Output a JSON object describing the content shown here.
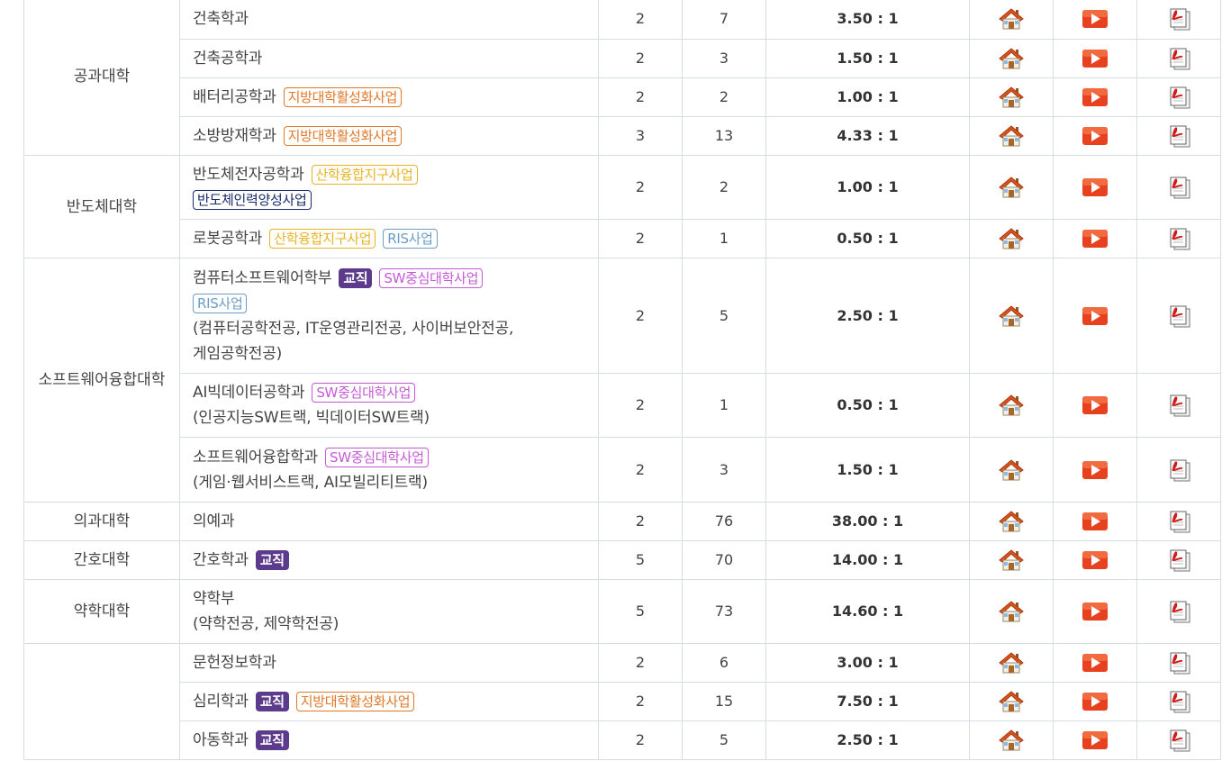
{
  "colors": {
    "orange": "#e0792a",
    "yellow": "#e8b422",
    "navy": "#1a2a6c",
    "blue": "#6b9cc7",
    "violet": "#c45ad6",
    "purple": "#5c3a8c"
  },
  "icons": {
    "home": "home-icon",
    "video": "play-video-icon",
    "pdf": "pdf-document-icon"
  },
  "colleges": [
    {
      "name": "공과대학",
      "rows": [
        {
          "dept": "건축학과",
          "tags": [],
          "sub": [],
          "quota": "2",
          "applicants": "7",
          "ratio": "3.50 : 1"
        },
        {
          "dept": "건축공학과",
          "tags": [],
          "sub": [],
          "quota": "2",
          "applicants": "3",
          "ratio": "1.50 : 1"
        },
        {
          "dept": "배터리공학과",
          "tags": [
            {
              "label": "지방대학활성화사업",
              "style": "orange"
            }
          ],
          "sub": [],
          "quota": "2",
          "applicants": "2",
          "ratio": "1.00 : 1"
        },
        {
          "dept": "소방방재학과",
          "tags": [
            {
              "label": "지방대학활성화사업",
              "style": "orange"
            }
          ],
          "sub": [],
          "quota": "3",
          "applicants": "13",
          "ratio": "4.33 : 1"
        }
      ]
    },
    {
      "name": "반도체대학",
      "rows": [
        {
          "dept": "반도체전자공학과",
          "tags": [
            {
              "label": "산학융합지구사업",
              "style": "yellow"
            }
          ],
          "tags2": [
            {
              "label": "반도체인력양성사업",
              "style": "navy"
            }
          ],
          "sub": [],
          "quota": "2",
          "applicants": "2",
          "ratio": "1.00 : 1"
        },
        {
          "dept": "로봇공학과",
          "tags": [
            {
              "label": "산학융합지구사업",
              "style": "yellow"
            },
            {
              "label": "RIS사업",
              "style": "blue"
            }
          ],
          "sub": [],
          "quota": "2",
          "applicants": "1",
          "ratio": "0.50 : 1"
        }
      ]
    },
    {
      "name": "소프트웨어융합대학",
      "rows": [
        {
          "dept": "컴퓨터소프트웨어학부",
          "tags": [
            {
              "label": "교직",
              "style": "purple"
            },
            {
              "label": "SW중심대학사업",
              "style": "violet"
            }
          ],
          "tags2": [
            {
              "label": "RIS사업",
              "style": "blue"
            }
          ],
          "sub": [
            "(컴퓨터공학전공, IT운영관리전공, 사이버보안전공,",
            "게임공학전공)"
          ],
          "quota": "2",
          "applicants": "5",
          "ratio": "2.50 : 1"
        },
        {
          "dept": "AI빅데이터공학과",
          "tags": [
            {
              "label": "SW중심대학사업",
              "style": "violet"
            }
          ],
          "sub": [
            "(인공지능SW트랙, 빅데이터SW트랙)"
          ],
          "quota": "2",
          "applicants": "1",
          "ratio": "0.50 : 1"
        },
        {
          "dept": "소프트웨어융합학과",
          "tags": [
            {
              "label": "SW중심대학사업",
              "style": "violet"
            }
          ],
          "sub": [
            "(게임·웹서비스트랙, AI모빌리티트랙)"
          ],
          "quota": "2",
          "applicants": "3",
          "ratio": "1.50 : 1"
        }
      ]
    },
    {
      "name": "의과대학",
      "rows": [
        {
          "dept": "의예과",
          "tags": [],
          "sub": [],
          "quota": "2",
          "applicants": "76",
          "ratio": "38.00 : 1"
        }
      ]
    },
    {
      "name": "간호대학",
      "rows": [
        {
          "dept": "간호학과",
          "tags": [
            {
              "label": "교직",
              "style": "purple"
            }
          ],
          "sub": [],
          "quota": "5",
          "applicants": "70",
          "ratio": "14.00 : 1"
        }
      ]
    },
    {
      "name": "약학대학",
      "rows": [
        {
          "dept": "약학부",
          "tags": [],
          "sub": [
            "(약학전공, 제약학전공)"
          ],
          "quota": "5",
          "applicants": "73",
          "ratio": "14.60 : 1"
        }
      ]
    },
    {
      "name": "",
      "rows": [
        {
          "dept": "문헌정보학과",
          "tags": [],
          "sub": [],
          "quota": "2",
          "applicants": "6",
          "ratio": "3.00 : 1"
        },
        {
          "dept": "심리학과",
          "tags": [
            {
              "label": "교직",
              "style": "purple"
            },
            {
              "label": "지방대학활성화사업",
              "style": "orange"
            }
          ],
          "sub": [],
          "quota": "2",
          "applicants": "15",
          "ratio": "7.50 : 1"
        },
        {
          "dept": "아동학과",
          "tags": [
            {
              "label": "교직",
              "style": "purple"
            }
          ],
          "sub": [],
          "quota": "2",
          "applicants": "5",
          "ratio": "2.50 : 1"
        }
      ]
    }
  ]
}
